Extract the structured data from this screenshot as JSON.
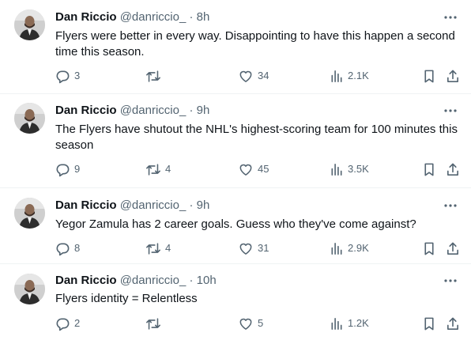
{
  "colors": {
    "text": "#0f1419",
    "muted": "#536471",
    "divider": "#eff3f4"
  },
  "tweets": [
    {
      "name": "Dan Riccio",
      "handle": "@danriccio_",
      "sep": "·",
      "time": "8h",
      "text": "Flyers were better in every way. Disappointing to have this happen a second time this season.",
      "replies": "3",
      "retweets": "",
      "likes": "34",
      "views": "2.1K"
    },
    {
      "name": "Dan Riccio",
      "handle": "@danriccio_",
      "sep": "·",
      "time": "9h",
      "text": "The Flyers have shutout the NHL's highest-scoring team for 100 minutes this season",
      "replies": "9",
      "retweets": "4",
      "likes": "45",
      "views": "3.5K"
    },
    {
      "name": "Dan Riccio",
      "handle": "@danriccio_",
      "sep": "·",
      "time": "9h",
      "text": "Yegor Zamula has 2 career goals. Guess who they've come against?",
      "replies": "8",
      "retweets": "4",
      "likes": "31",
      "views": "2.9K"
    },
    {
      "name": "Dan Riccio",
      "handle": "@danriccio_",
      "sep": "·",
      "time": "10h",
      "text": "Flyers identity = Relentless",
      "replies": "2",
      "retweets": "",
      "likes": "5",
      "views": "1.2K"
    }
  ]
}
